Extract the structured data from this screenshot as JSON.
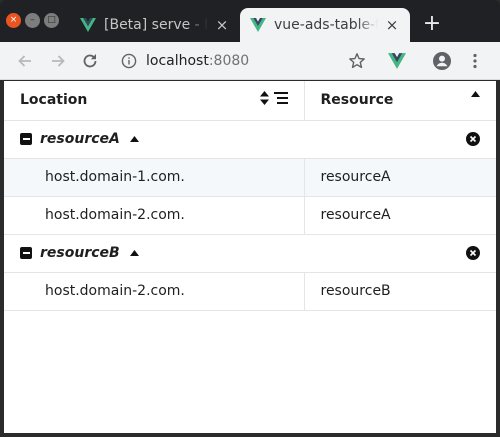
{
  "browser": {
    "tabs": [
      {
        "title": "[Beta] serve - Pr",
        "active": false
      },
      {
        "title": "vue-ads-table-tr",
        "active": true
      }
    ],
    "url_host": "localhost",
    "url_port": ":8080"
  },
  "table": {
    "headers": {
      "location": "Location",
      "resource": "Resource"
    },
    "groups": [
      {
        "name": "resourceA",
        "rows": [
          {
            "location": "host.domain-1.com.",
            "resource": "resourceA"
          },
          {
            "location": "host.domain-2.com.",
            "resource": "resourceA"
          }
        ]
      },
      {
        "name": "resourceB",
        "rows": [
          {
            "location": "host.domain-2.com.",
            "resource": "resourceB"
          }
        ]
      }
    ]
  },
  "colors": {
    "accent": "#e95420",
    "vue_green": "#41b883",
    "vue_dark": "#35495e",
    "row_alt": "#f4f8fb"
  }
}
